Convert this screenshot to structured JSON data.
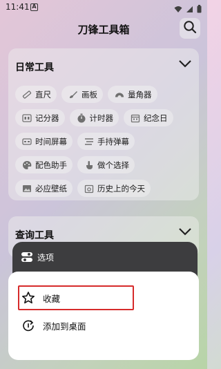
{
  "status_bar": {
    "time": "11:41",
    "notification_badge": "A",
    "icons": [
      "wifi-icon",
      "signal-icon",
      "battery-icon"
    ]
  },
  "app": {
    "title": "刀锋工具箱",
    "search_icon": "search-icon"
  },
  "daily_tools": {
    "title": "日常工具",
    "chips": [
      {
        "label": "直尺",
        "icon": "ruler-icon"
      },
      {
        "label": "画板",
        "icon": "palette-brush-icon"
      },
      {
        "label": "量角器",
        "icon": "protractor-icon"
      },
      {
        "label": "记分器",
        "icon": "scoreboard-icon"
      },
      {
        "label": "计时器",
        "icon": "timer-icon"
      },
      {
        "label": "纪念日",
        "icon": "calendar-icon"
      },
      {
        "label": "时间屏幕",
        "icon": "clock-screen-icon"
      },
      {
        "label": "手持弹幕",
        "icon": "marquee-icon"
      },
      {
        "label": "配色助手",
        "icon": "color-palette-icon"
      },
      {
        "label": "做个选择",
        "icon": "hand-pick-icon"
      },
      {
        "label": "必应壁纸",
        "icon": "wallpaper-icon"
      },
      {
        "label": "历史上的今天",
        "icon": "history-calendar-icon"
      }
    ]
  },
  "query_tools": {
    "title": "查询工具"
  },
  "context_menu": {
    "header_label": "选项",
    "items": [
      {
        "label": "收藏",
        "icon": "star-icon",
        "highlighted": true
      },
      {
        "label": "添加到桌面",
        "icon": "add-to-home-icon",
        "highlighted": false
      }
    ]
  },
  "colors": {
    "highlight_border": "#d62a2a",
    "menu_header_bg": "#3d3d3f"
  }
}
